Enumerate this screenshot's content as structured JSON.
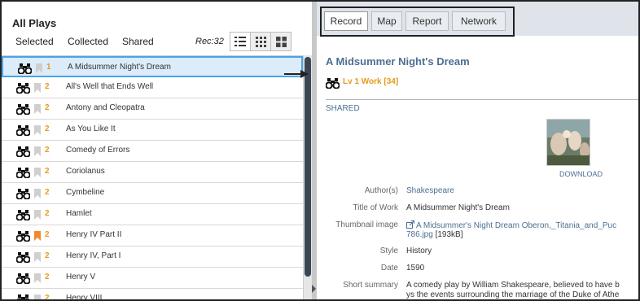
{
  "left_panel": {
    "title": "All Plays",
    "filters": [
      "Selected",
      "Collected",
      "Shared"
    ],
    "record_count": "Rec:32",
    "view_modes": [
      "list-view-icon",
      "grid-small-icon",
      "grid-large-icon"
    ]
  },
  "plays": [
    {
      "level": "1",
      "title": "A Midsummer Night's Dream",
      "selected": true,
      "bookmarked": false
    },
    {
      "level": "2",
      "title": "All's Well that Ends Well",
      "selected": false,
      "bookmarked": false
    },
    {
      "level": "2",
      "title": "Antony and Cleopatra",
      "selected": false,
      "bookmarked": false
    },
    {
      "level": "2",
      "title": "As You Like It",
      "selected": false,
      "bookmarked": false
    },
    {
      "level": "2",
      "title": "Comedy of Errors",
      "selected": false,
      "bookmarked": false
    },
    {
      "level": "2",
      "title": "Coriolanus",
      "selected": false,
      "bookmarked": false
    },
    {
      "level": "2",
      "title": "Cymbeline",
      "selected": false,
      "bookmarked": false
    },
    {
      "level": "2",
      "title": "Hamlet",
      "selected": false,
      "bookmarked": false
    },
    {
      "level": "2",
      "title": "Henry IV Part II",
      "selected": false,
      "bookmarked": true
    },
    {
      "level": "2",
      "title": "Henry IV, Part I",
      "selected": false,
      "bookmarked": false
    },
    {
      "level": "2",
      "title": "Henry V",
      "selected": false,
      "bookmarked": false
    },
    {
      "level": "2",
      "title": "Henry VIII",
      "selected": false,
      "bookmarked": false
    }
  ],
  "detail_tabs": [
    "Record",
    "Map",
    "Report",
    "Network"
  ],
  "record": {
    "title": "A Midsummer Night's Dream",
    "level": "Lv 1 Work [34]",
    "shared": "SHARED",
    "download": "DOWNLOAD",
    "fields": [
      {
        "label": "Author(s)",
        "value": "Shakespeare",
        "link": true
      },
      {
        "label": "Title of Work",
        "value": "A Midsummer Night's Dream",
        "link": false
      },
      {
        "label": "Thumbnail image",
        "value": "A Midsummer's Night Dream Oberon,_Titania_and_Puc",
        "value2": "786.jpg",
        "suffix": " [193kB]",
        "link": true
      },
      {
        "label": "Style",
        "value": "History",
        "link": false
      },
      {
        "label": "Date",
        "value": "1590",
        "link": false
      },
      {
        "label": "Short summary",
        "value": "A comedy play by William Shakespeare, believed to have b",
        "value2": "ys the events surrounding the marriage of the Duke of Athe",
        "link": false
      }
    ]
  },
  "colors": {
    "accent": "#4d6f91",
    "level": "#e89a1a",
    "selection": "#4aa3e8",
    "bookmark_active": "#f08a2a"
  }
}
